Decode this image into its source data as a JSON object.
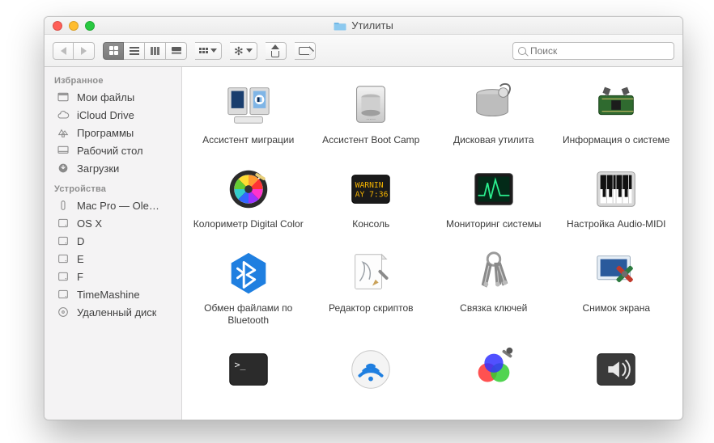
{
  "window": {
    "title": "Утилиты"
  },
  "search": {
    "placeholder": "Поиск"
  },
  "sidebar": {
    "sections": [
      {
        "header": "Избранное",
        "items": [
          {
            "icon": "all-my-files",
            "label": "Мои файлы"
          },
          {
            "icon": "icloud",
            "label": "iCloud Drive"
          },
          {
            "icon": "apps",
            "label": "Программы"
          },
          {
            "icon": "desktop",
            "label": "Рабочий стол"
          },
          {
            "icon": "downloads",
            "label": "Загрузки"
          }
        ]
      },
      {
        "header": "Устройства",
        "items": [
          {
            "icon": "macpro",
            "label": "Mac Pro — Ole…"
          },
          {
            "icon": "hdd",
            "label": "OS X"
          },
          {
            "icon": "hdd",
            "label": "D"
          },
          {
            "icon": "hdd",
            "label": "E"
          },
          {
            "icon": "hdd",
            "label": "F"
          },
          {
            "icon": "hdd",
            "label": "TimeMashine"
          },
          {
            "icon": "optical",
            "label": "Удаленный диск"
          }
        ]
      }
    ]
  },
  "apps": [
    {
      "icon": "migration",
      "label": "Ассистент миграции"
    },
    {
      "icon": "bootcamp",
      "label": "Ассистент Boot Camp"
    },
    {
      "icon": "diskutil",
      "label": "Дисковая утилита"
    },
    {
      "icon": "sysinfo",
      "label": "Информация о системе"
    },
    {
      "icon": "colorimeter",
      "label": "Колориметр Digital Color"
    },
    {
      "icon": "console",
      "label": "Консоль"
    },
    {
      "icon": "activity",
      "label": "Мониторинг системы"
    },
    {
      "icon": "audiomidi",
      "label": "Настройка Audio-MIDI"
    },
    {
      "icon": "bluetooth",
      "label": "Обмен файлами по Bluetooth"
    },
    {
      "icon": "scripteditor",
      "label": "Редактор скриптов"
    },
    {
      "icon": "keychain",
      "label": "Связка ключей"
    },
    {
      "icon": "screenshot",
      "label": "Снимок экрана"
    },
    {
      "icon": "terminal",
      "label": ""
    },
    {
      "icon": "airport",
      "label": ""
    },
    {
      "icon": "colorsync",
      "label": ""
    },
    {
      "icon": "voiceover",
      "label": ""
    }
  ]
}
